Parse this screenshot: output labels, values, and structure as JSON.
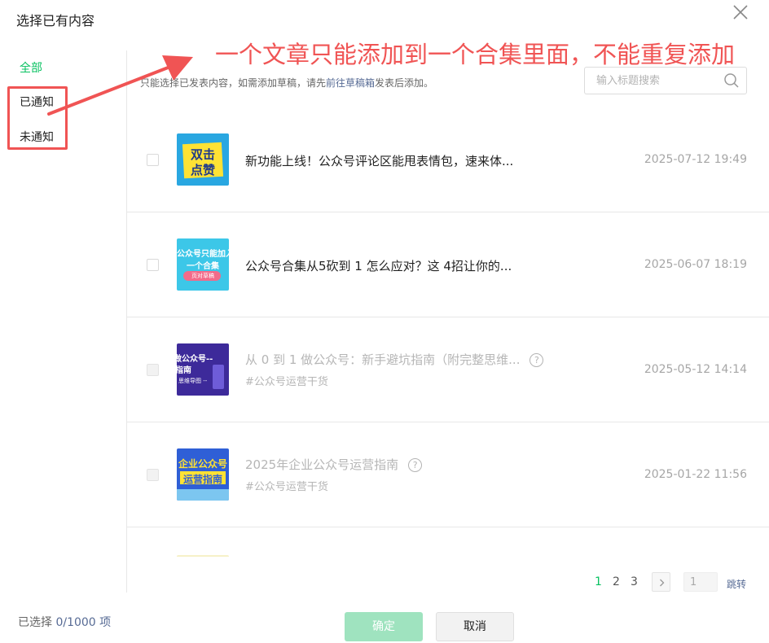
{
  "dialog": {
    "title": "选择已有内容"
  },
  "sidebar": {
    "items": [
      {
        "label": "全部",
        "active": true
      },
      {
        "label": "已通知",
        "active": false
      },
      {
        "label": "未通知",
        "active": false
      }
    ]
  },
  "annotation": {
    "text": "一个文章只能添加到一个合集里面，不能重复添加",
    "color": "#f05454"
  },
  "tip": {
    "before": "只能选择已发表内容，如需添加草稿，请先",
    "link": "前往草稿箱",
    "after": "发表后添加。"
  },
  "search": {
    "placeholder": "输入标题搜索",
    "value": ""
  },
  "articles": [
    {
      "thumb_lines": [
        "双击",
        "点赞"
      ],
      "title": "新功能上线！公众号评论区能甩表情包，速来体...",
      "tag": "",
      "date": "2025-07-12 19:49",
      "disabled": false
    },
    {
      "thumb_lines": [
        "公众号只能加入",
        "一个合集",
        "页对草稿"
      ],
      "title": "公众号合集从5砍到 1 怎么应对？这 4招让你的...",
      "tag": "",
      "date": "2025-06-07 18:19",
      "disabled": false
    },
    {
      "thumb_lines": [
        "做公众号--",
        "指南",
        "思维导图 --"
      ],
      "title": "从 0 到 1 做公众号：新手避坑指南（附完整思维...",
      "tag": "#公众号运营干货",
      "date": "2025-05-12 14:14",
      "disabled": true
    },
    {
      "thumb_lines": [
        "企业公众号",
        "运营指南"
      ],
      "title": "2025年企业公众号运营指南",
      "tag": "#公众号运营干货",
      "date": "2025-01-22 11:56",
      "disabled": true
    }
  ],
  "pagination": {
    "pages": [
      "1",
      "2",
      "3"
    ],
    "current": "1",
    "input_value": "1",
    "jump_label": "跳转"
  },
  "footer": {
    "selected_label": "已选择",
    "selected_value": "0/1000",
    "selected_unit": "项",
    "confirm_label": "确定",
    "cancel_label": "取消"
  },
  "colors": {
    "accent": "#07c160",
    "link": "#576b95",
    "confirm_disabled": "#9fe3bf",
    "annotation": "#f05454"
  }
}
